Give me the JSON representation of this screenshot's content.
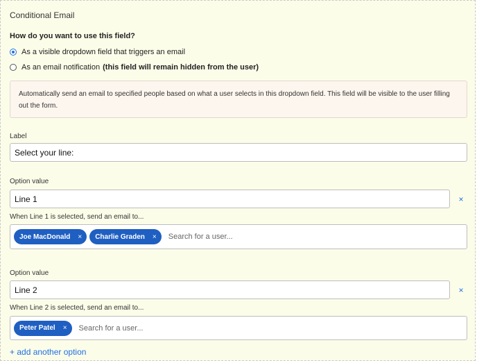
{
  "section_title": "Conditional Email",
  "usage": {
    "question": "How do you want to use this field?",
    "options": [
      {
        "label": "As a visible dropdown field that triggers an email",
        "bold_suffix": "",
        "checked": true
      },
      {
        "label": "As an email notification",
        "bold_suffix": "(this field will remain hidden from the user)",
        "checked": false
      }
    ]
  },
  "info_text": "Automatically send an email to specified people based on what a user selects in this dropdown field. This field will be visible to the user filling out the form.",
  "label_field": {
    "label": "Label",
    "value": "Select your line:"
  },
  "options": [
    {
      "label": "Option value",
      "value": "Line 1",
      "remove_icon": "×",
      "recipients_label": "When Line 1 is selected, send an email to...",
      "recipients": [
        "Joe MacDonald",
        "Charlie Graden"
      ],
      "search_placeholder": "Search for a user..."
    },
    {
      "label": "Option value",
      "value": "Line 2",
      "remove_icon": "×",
      "recipients_label": "When Line 2 is selected, send an email to...",
      "recipients": [
        "Peter Patel"
      ],
      "search_placeholder": "Search for a user..."
    }
  ],
  "chip_remove_icon": "×",
  "add_option_label": "+ add another option",
  "colors": {
    "accent": "#1d6fe3",
    "chip": "#1f5fc2",
    "panel_bg": "#fcfde9",
    "info_bg": "#fdf6ee"
  }
}
